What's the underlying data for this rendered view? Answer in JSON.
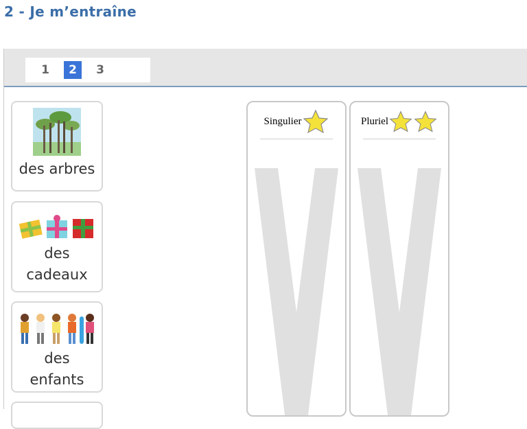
{
  "page": {
    "title": "2 - Je m’entraîne"
  },
  "pager": {
    "pages": [
      "1",
      "2",
      "3"
    ],
    "active": "2"
  },
  "cards": [
    {
      "label": "des arbres",
      "icon": "trees-icon"
    },
    {
      "label_line1": "des",
      "label_line2": "cadeaux",
      "icon": "gifts-icon"
    },
    {
      "label_line1": "des",
      "label_line2": "enfants",
      "icon": "children-icon"
    }
  ],
  "columns": [
    {
      "label": "Singulier",
      "stars": 1
    },
    {
      "label": "Pluriel",
      "stars": 2
    }
  ],
  "colors": {
    "title": "#3b6ea8",
    "active_page": "#3a74d8",
    "star": "#f4e23a",
    "watermark": "#e0e0e0"
  }
}
